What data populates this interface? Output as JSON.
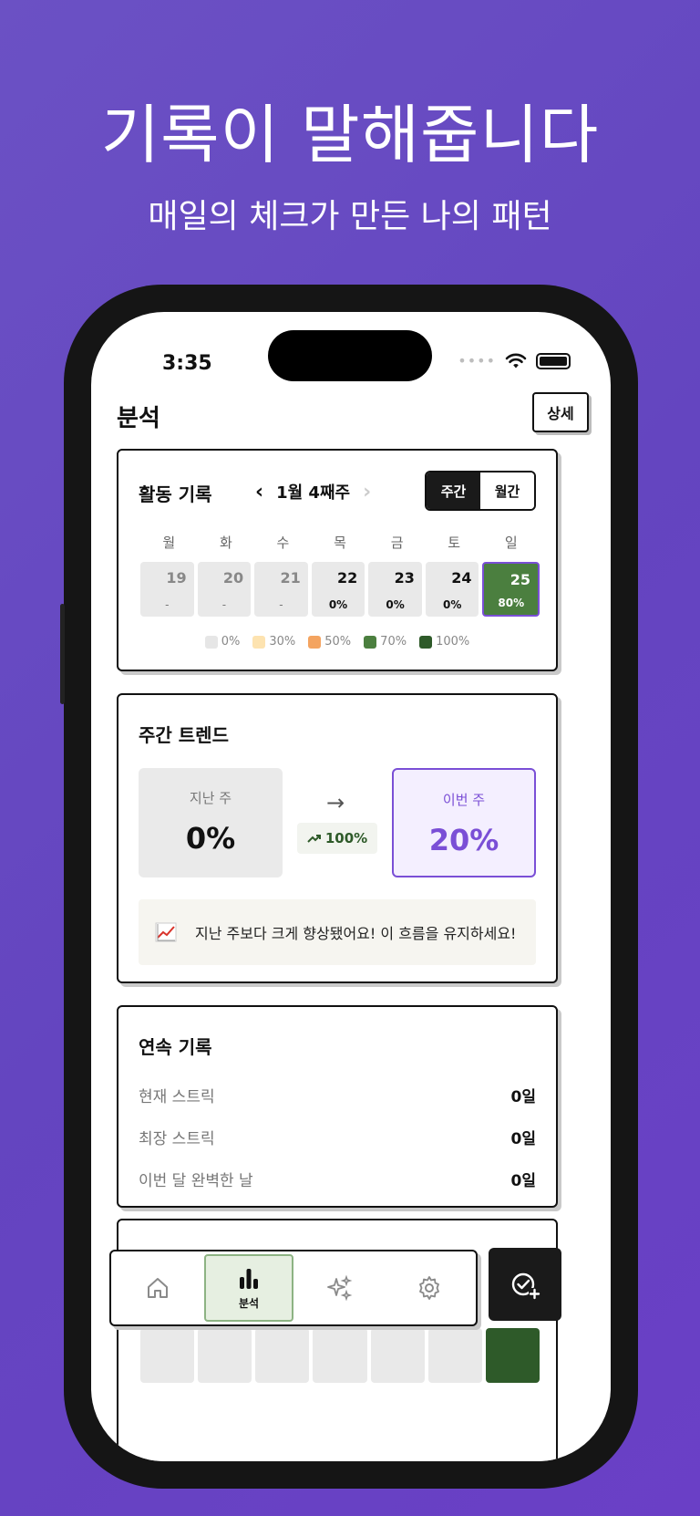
{
  "promo": {
    "headline": "기록이 말해줍니다",
    "subline": "매일의 체크가 만든 나의 패턴"
  },
  "status": {
    "time": "3:35"
  },
  "header": {
    "title": "분석",
    "detail_label": "상세"
  },
  "activity": {
    "title": "활동 기록",
    "week_label": "1월 4째주",
    "toggle": {
      "weekly": "주간",
      "monthly": "월간",
      "selected": "weekly"
    },
    "weekdays": [
      "월",
      "화",
      "수",
      "목",
      "금",
      "토",
      "일"
    ],
    "days": [
      {
        "num": "19",
        "pct": "-"
      },
      {
        "num": "20",
        "pct": "-"
      },
      {
        "num": "21",
        "pct": "-"
      },
      {
        "num": "22",
        "pct": "0%"
      },
      {
        "num": "23",
        "pct": "0%"
      },
      {
        "num": "24",
        "pct": "0%"
      },
      {
        "num": "25",
        "pct": "80%"
      }
    ],
    "legend": [
      {
        "label": "0%",
        "color": "#e6e6e6"
      },
      {
        "label": "30%",
        "color": "#fde3b0"
      },
      {
        "label": "50%",
        "color": "#f4a460"
      },
      {
        "label": "70%",
        "color": "#4b7f3f"
      },
      {
        "label": "100%",
        "color": "#2e5a29"
      }
    ]
  },
  "trend": {
    "title": "주간 트렌드",
    "last_label": "지난 주",
    "last_value": "0%",
    "this_label": "이번 주",
    "this_value": "20%",
    "change": "100%",
    "message": "지난 주보다 크게 향상됐어요! 이 흐름을 유지하세요!"
  },
  "streak": {
    "title": "연속 기록",
    "rows": [
      {
        "label": "현재 스트릭",
        "value": "0일"
      },
      {
        "label": "최장 스트릭",
        "value": "0일"
      },
      {
        "label": "이번 달 완벽한 날",
        "value": "0일"
      }
    ]
  },
  "tabbar": {
    "items": [
      {
        "icon": "home-icon"
      },
      {
        "icon": "bar-chart-icon",
        "label": "분석"
      },
      {
        "icon": "sparkles-icon"
      },
      {
        "icon": "gear-icon"
      }
    ]
  },
  "colors": {
    "accent_purple": "#7a4fd6",
    "accent_green": "#4b7f3f",
    "dark_green": "#2e5a29"
  }
}
